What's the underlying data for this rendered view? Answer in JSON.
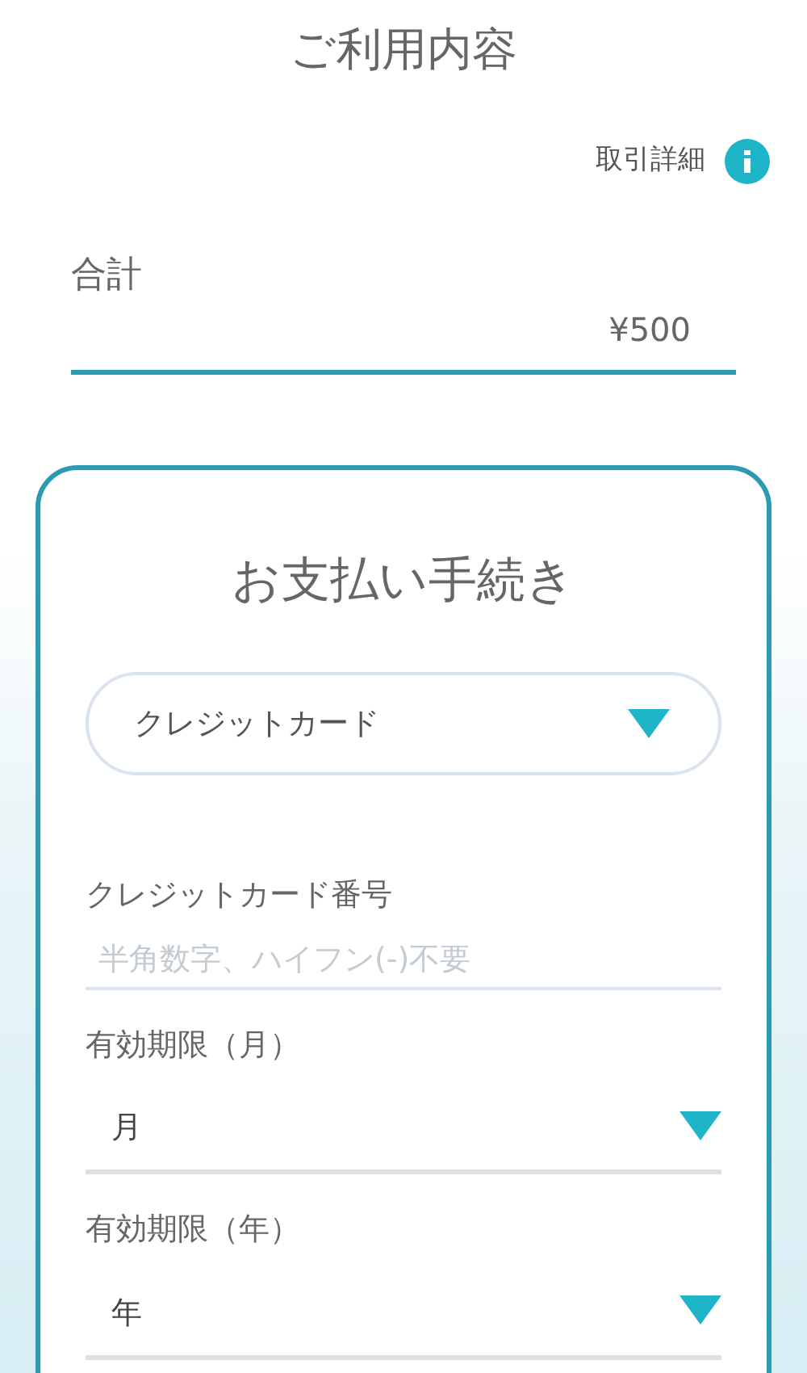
{
  "title": "ご利用内容",
  "details_link": {
    "label": "取引詳細"
  },
  "total": {
    "label": "合計",
    "amount": "¥500"
  },
  "payment": {
    "title": "お支払い手続き",
    "method_select": {
      "value": "クレジットカード"
    },
    "fields": [
      {
        "kind": "text",
        "label": "クレジットカード番号",
        "placeholder": "半角数字、ハイフン(-)不要"
      },
      {
        "kind": "select",
        "label": "有効期限（月）",
        "value": "月"
      },
      {
        "kind": "select",
        "label": "有効期限（年）",
        "value": "年"
      }
    ]
  }
}
